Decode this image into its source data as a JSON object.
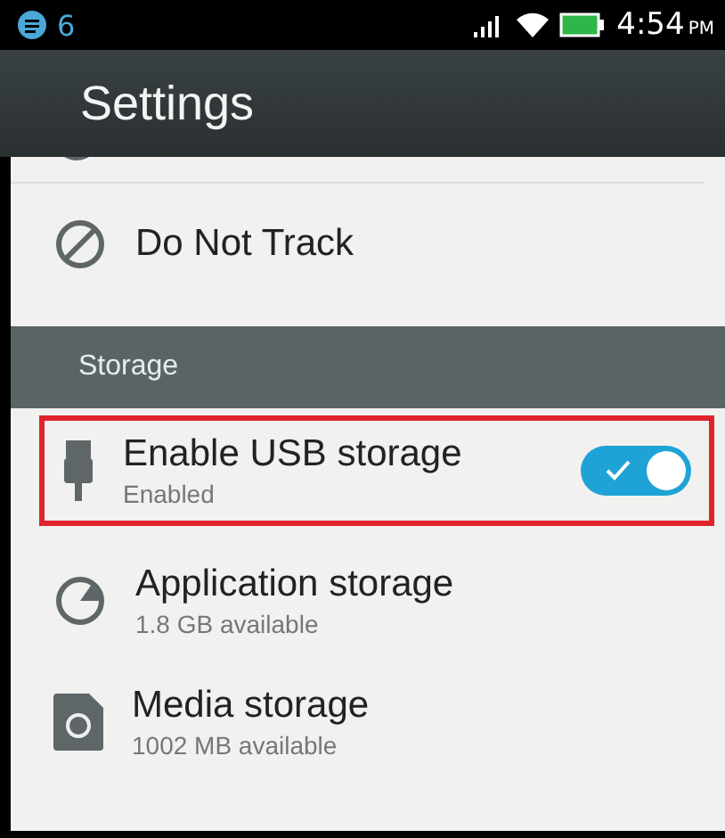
{
  "status_bar": {
    "notification_count": "6",
    "time": "4:54",
    "meridiem": "PM"
  },
  "header": {
    "title": "Settings"
  },
  "items": [
    {
      "kind": "partial"
    },
    {
      "kind": "row",
      "title": "Do Not Track"
    },
    {
      "kind": "section",
      "title": "Storage"
    },
    {
      "kind": "row",
      "title": "Enable USB storage",
      "subtitle": "Enabled",
      "toggle": {
        "on": true
      },
      "highlighted": true
    },
    {
      "kind": "row",
      "title": "Application storage",
      "subtitle": "1.8 GB available"
    },
    {
      "kind": "row",
      "title": "Media storage",
      "subtitle": "1002 MB available"
    }
  ]
}
